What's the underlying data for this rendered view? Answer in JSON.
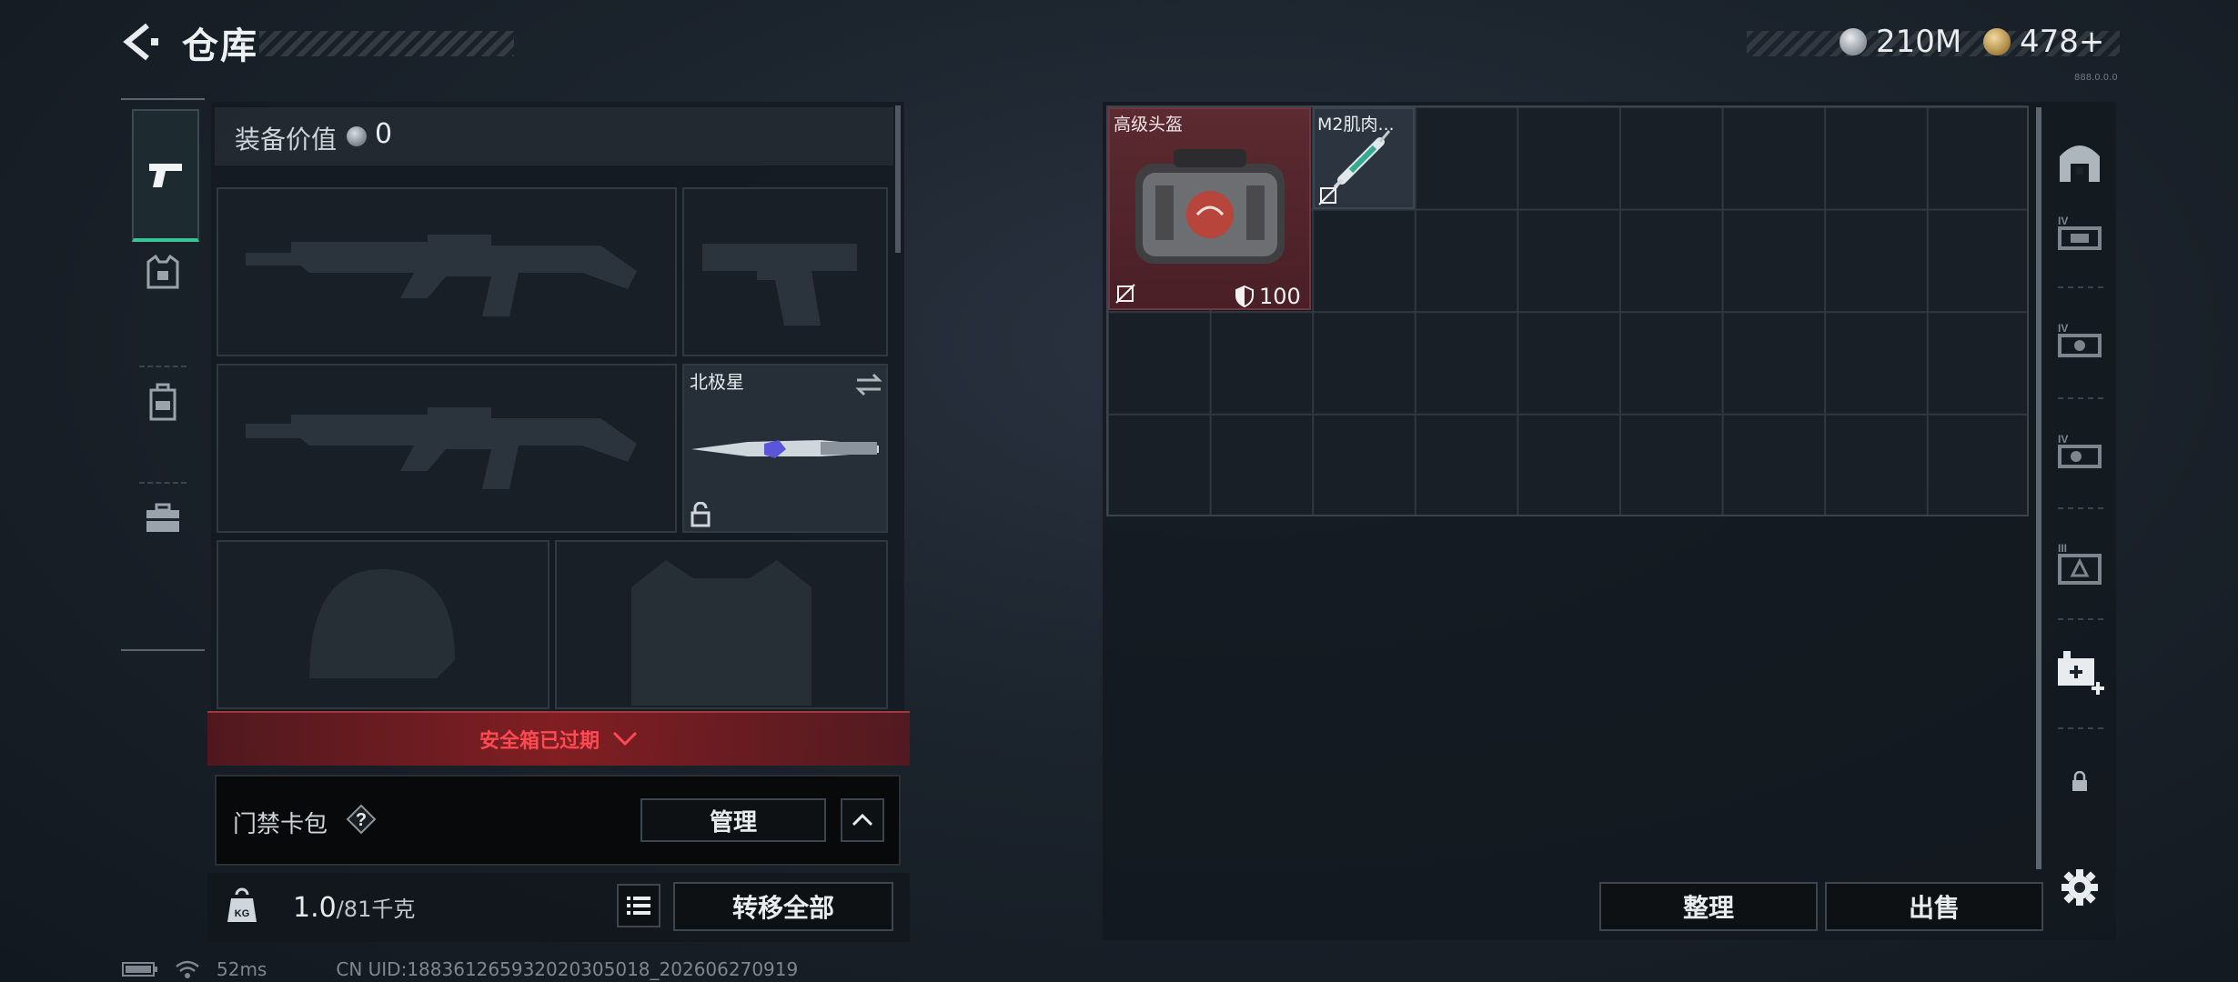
{
  "header": {
    "title": "仓库",
    "currency_silver": "210M",
    "currency_gold": "478+",
    "version": "888.0.0.0"
  },
  "loadout": {
    "equip_value_label": "装备价值",
    "equip_value": "0",
    "melee_name": "北极星",
    "safe_box_text": "安全箱已过期",
    "keycard_label": "门禁卡包",
    "keycard_help": "?",
    "manage_label": "管理",
    "weight_current": "1.0",
    "weight_max": "/81千克",
    "transfer_all_label": "转移全部"
  },
  "warehouse": {
    "items": [
      {
        "name": "高级头盔",
        "durability": "100"
      },
      {
        "name": "M2肌肉..."
      }
    ],
    "sort_label": "整理",
    "sell_label": "出售"
  },
  "status": {
    "ping": "52ms",
    "uid": "CN UID:188361265932020305018_202606270919"
  },
  "colors": {
    "accent_green": "#39c39a",
    "alert_red": "#ff4a52",
    "item_red_bg": "#5c2a31"
  },
  "icons": {
    "back": "chevron-left-icon",
    "weapon_tab": "pistol-icon",
    "armor_tab": "vest-icon",
    "backpack_tab": "backpack-icon",
    "toolbox_tab": "toolbox-icon"
  }
}
